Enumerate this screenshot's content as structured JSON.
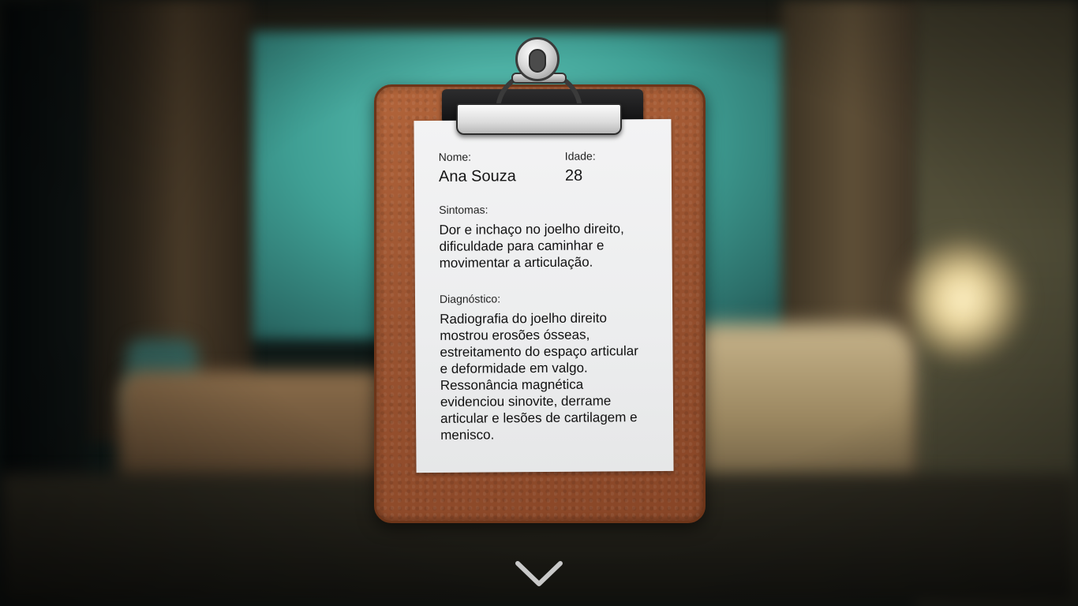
{
  "patient_card": {
    "name_label": "Nome:",
    "name": "Ana Souza",
    "age_label": "Idade:",
    "age": "28",
    "symptoms_label": "Sintomas:",
    "symptoms": "Dor e inchaço no joelho direito, dificuldade para caminhar e movimentar a articulação.",
    "diagnosis_label": "Diagnóstico:",
    "diagnosis": "Radiografia do joelho direito mostrou erosões ósseas, estreitamento do espaço articular e deformidade em valgo. Ressonância magnética evidenciou sinovite, derrame articular e lesões de cartilagem e menisco."
  },
  "navigation": {
    "next_icon": "chevron-down-icon"
  },
  "colors": {
    "clipboard": "#9a5330",
    "paper": "#ededee",
    "wall": "#4fb3a6",
    "arrow": "#c9c9c9"
  }
}
